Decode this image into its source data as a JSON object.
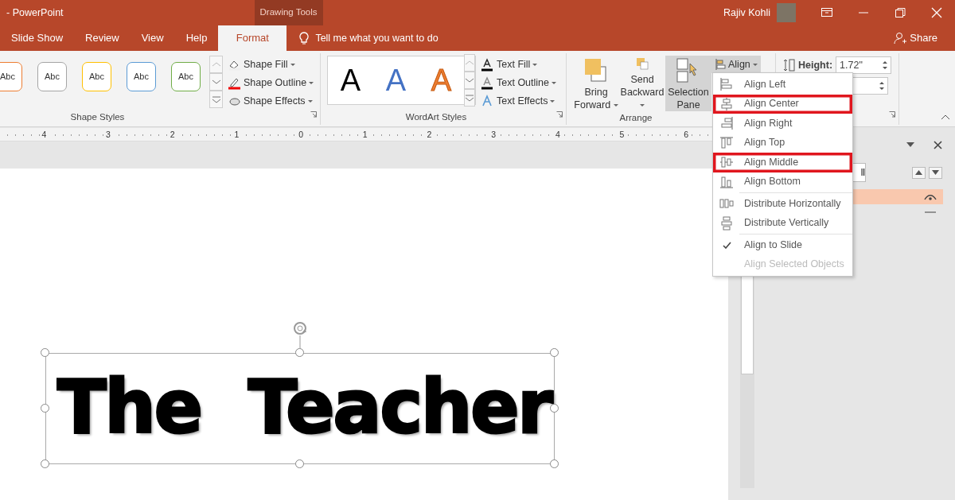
{
  "title_bar": {
    "title": "- PowerPoint",
    "context_group": "Drawing Tools",
    "user": "Rajiv Kohli"
  },
  "tabs": [
    {
      "label": "Slide Show",
      "selected": false
    },
    {
      "label": "Review",
      "selected": false
    },
    {
      "label": "View",
      "selected": false
    },
    {
      "label": "Help",
      "selected": false
    },
    {
      "label": "Format",
      "selected": true
    }
  ],
  "tell_me": "Tell me what you want to do",
  "share": "Share",
  "ribbon": {
    "shape_styles": {
      "label": "Shape Styles",
      "presets": [
        {
          "text": "Abc",
          "color": "#ed7d31"
        },
        {
          "text": "Abc",
          "color": "#a5a5a5"
        },
        {
          "text": "Abc",
          "color": "#ffc000"
        },
        {
          "text": "Abc",
          "color": "#5b9bd5"
        },
        {
          "text": "Abc",
          "color": "#70ad47"
        }
      ],
      "commands": [
        "Shape Fill",
        "Shape Outline",
        "Shape Effects"
      ]
    },
    "wordart_styles": {
      "label": "WordArt Styles",
      "presets": [
        {
          "text": "A",
          "kind": "fill",
          "color": "#000000"
        },
        {
          "text": "A",
          "kind": "fill",
          "color": "#4472c4"
        },
        {
          "text": "A",
          "kind": "outline",
          "color": "#ed7d31"
        }
      ],
      "commands": [
        "Text Fill",
        "Text Outline",
        "Text Effects"
      ]
    },
    "arrange": {
      "label": "Arrange",
      "buttons": [
        {
          "kind": "bring",
          "lines": [
            "Bring",
            "Forward"
          ],
          "pressed": false
        },
        {
          "kind": "send",
          "lines": [
            "Send",
            "Backward"
          ],
          "pressed": false
        },
        {
          "kind": "selection",
          "lines": [
            "Selection",
            "Pane"
          ],
          "pressed": true
        }
      ],
      "align": {
        "label": "Align",
        "pressed": true
      }
    },
    "size": {
      "height_label": "Height:",
      "height_value": "1.72\""
    }
  },
  "ruler": {
    "labels": [
      "4",
      "3",
      "2",
      "1",
      "0",
      "1",
      "2",
      "3",
      "4",
      "5",
      "6"
    ]
  },
  "slide": {
    "text": "The Teacher",
    "selected": true
  },
  "selection_pane": {
    "button_fragment": "ll",
    "rows": [
      {
        "selected": true,
        "visible": true
      },
      {
        "selected": false,
        "visible": false
      }
    ]
  },
  "align_menu": {
    "sections": [
      [
        {
          "label": "Align Left",
          "kind": "left",
          "checked": false,
          "disabled": false,
          "highlighted": false
        },
        {
          "label": "Align Center",
          "kind": "center",
          "checked": false,
          "disabled": false,
          "highlighted": true
        },
        {
          "label": "Align Right",
          "kind": "right",
          "checked": false,
          "disabled": false,
          "highlighted": false
        },
        {
          "label": "Align Top",
          "kind": "top",
          "checked": false,
          "disabled": false,
          "highlighted": false
        },
        {
          "label": "Align Middle",
          "kind": "middle",
          "checked": false,
          "disabled": false,
          "highlighted": true
        },
        {
          "label": "Align Bottom",
          "kind": "bottom",
          "checked": false,
          "disabled": false,
          "highlighted": false
        }
      ],
      [
        {
          "label": "Distribute Horizontally",
          "kind": "dist-h",
          "checked": false,
          "disabled": false,
          "highlighted": false
        },
        {
          "label": "Distribute Vertically",
          "kind": "dist-v",
          "checked": false,
          "disabled": false,
          "highlighted": false
        }
      ],
      [
        {
          "label": "Align to Slide",
          "kind": "option",
          "checked": true,
          "disabled": false,
          "highlighted": false
        },
        {
          "label": "Align Selected Objects",
          "kind": "option",
          "checked": false,
          "disabled": true,
          "highlighted": false
        }
      ]
    ]
  }
}
